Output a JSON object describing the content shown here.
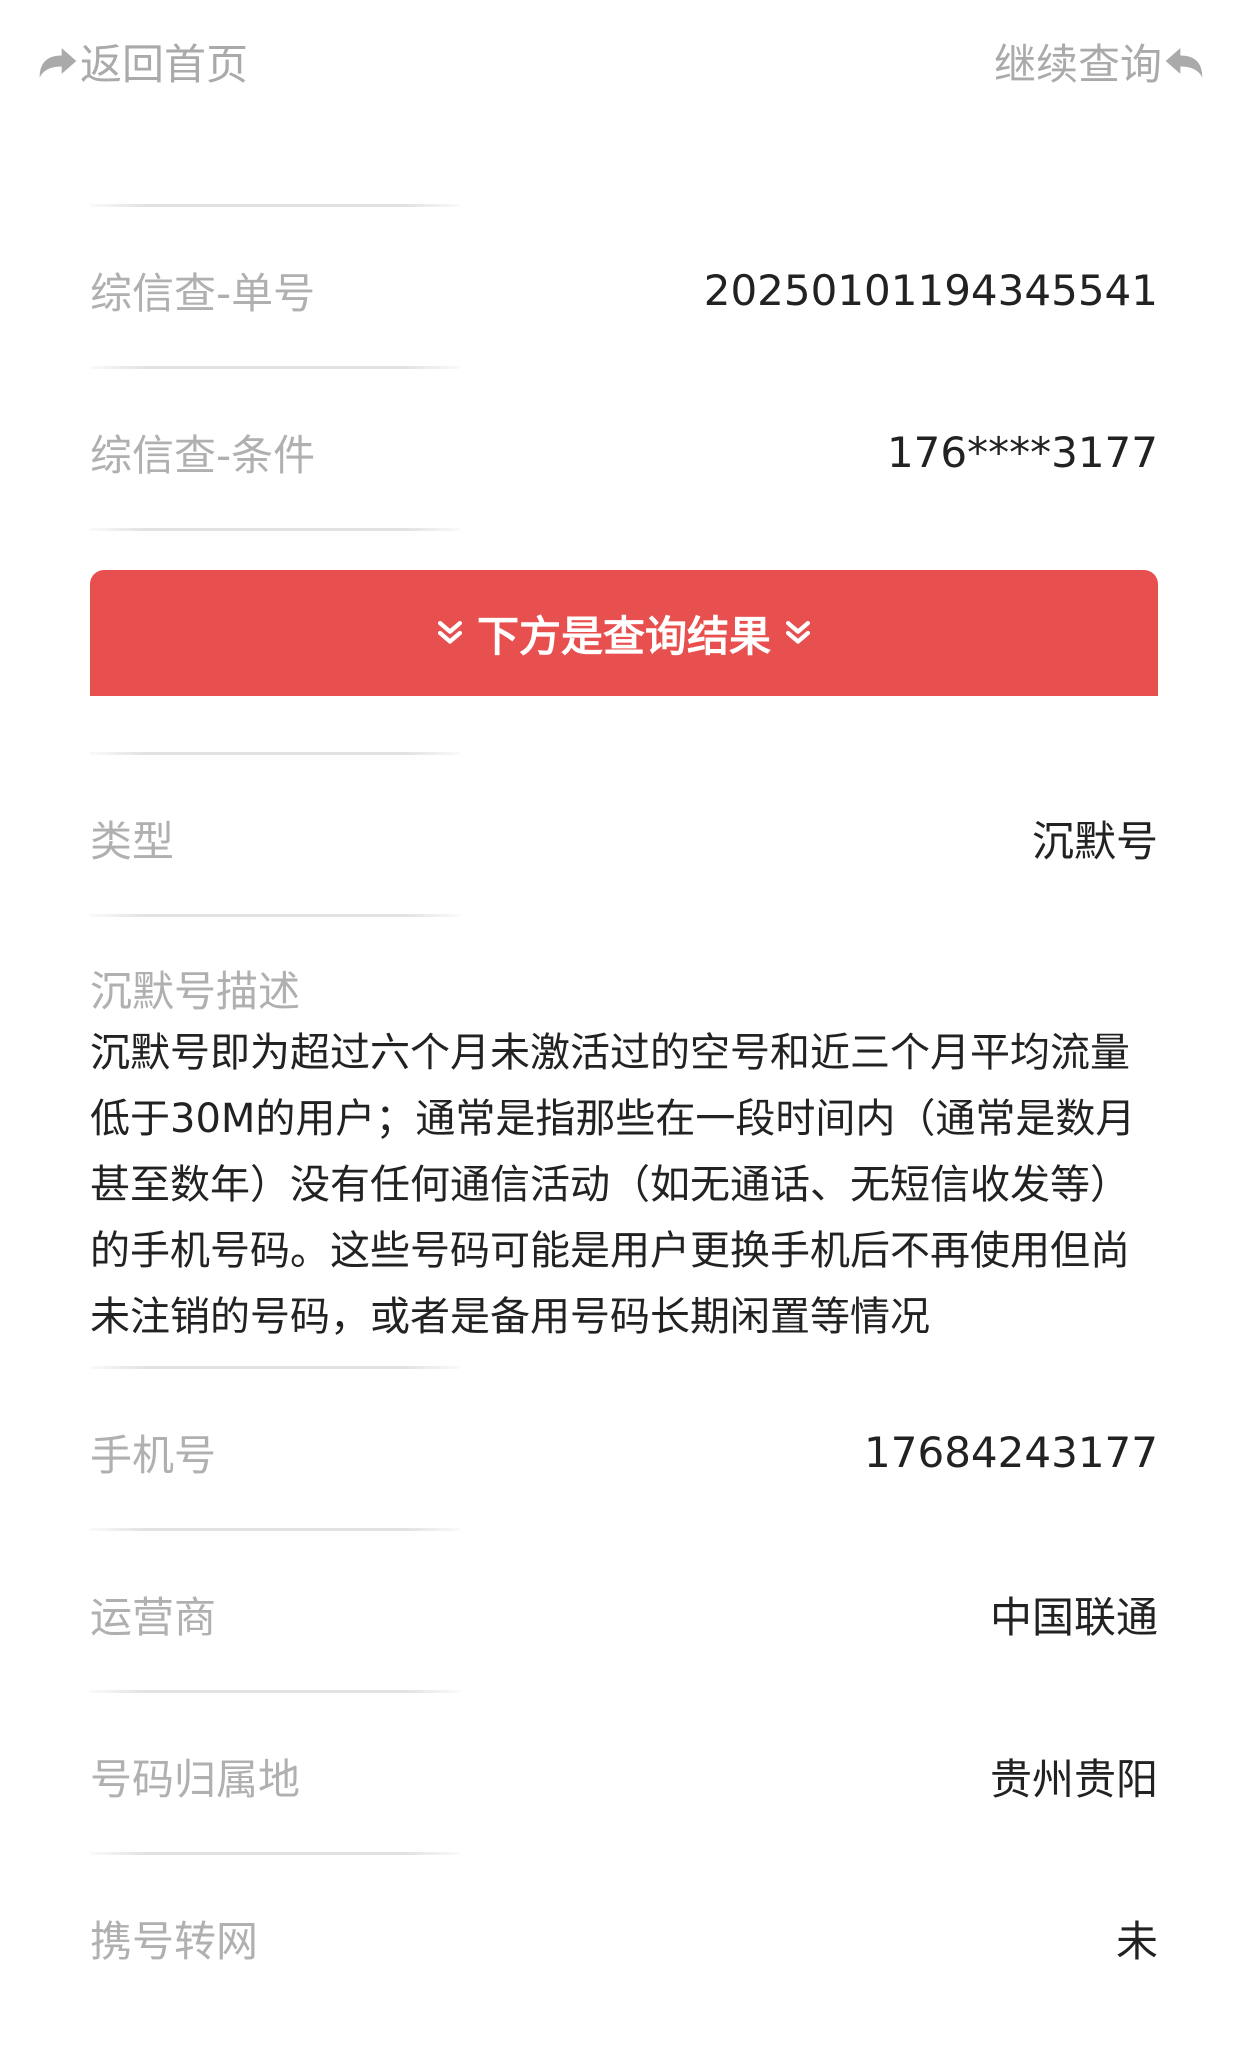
{
  "nav": {
    "back_label": "返回首页",
    "next_label": "继续查询"
  },
  "query": {
    "order_label": "综信查-单号",
    "order_value": "20250101194345541",
    "condition_label": "综信查-条件",
    "condition_value": "176****3177"
  },
  "banner": {
    "text": "下方是查询结果"
  },
  "result": {
    "type_label": "类型",
    "type_value": "沉默号",
    "desc_label": "沉默号描述",
    "desc_text": "沉默号即为超过六个月未激活过的空号和近三个月平均流量低于30M的用户；通常是指那些在一段时间内（通常是数月甚至数年）没有任何通信活动（如无通话、无短信收发等）的手机号码。这些号码可能是用户更换手机后不再使用但尚未注销的号码，或者是备用号码长期闲置等情况",
    "phone_label": "手机号",
    "phone_value": "17684243177",
    "carrier_label": "运营商",
    "carrier_value": "中国联通",
    "location_label": "号码归属地",
    "location_value": "贵州贵阳",
    "portability_label": "携号转网",
    "portability_value": "未"
  },
  "icons": {
    "back": "share-arrow-icon",
    "next": "reply-arrow-icon",
    "banner": "double-chevron-down-icon"
  },
  "colors": {
    "banner_bg": "#e85050",
    "label": "#b0b0b0",
    "value": "#222222",
    "nav": "#aaaaaa"
  }
}
